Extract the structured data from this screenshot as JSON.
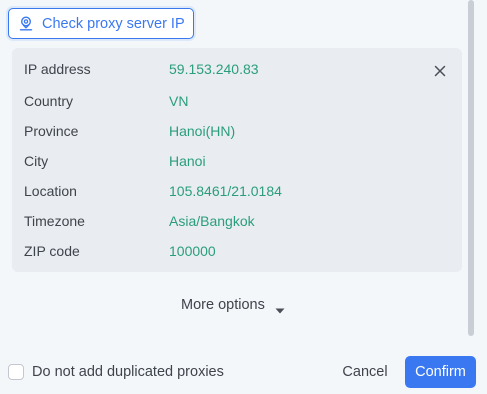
{
  "check_button": {
    "label": "Check proxy server IP",
    "icon": "location-pin-icon"
  },
  "info": {
    "rows": [
      {
        "label": "IP address",
        "value": "59.153.240.83"
      },
      {
        "label": "Country",
        "value": "VN"
      },
      {
        "label": "Province",
        "value": "Hanoi(HN)"
      },
      {
        "label": "City",
        "value": "Hanoi"
      },
      {
        "label": "Location",
        "value": "105.8461/21.0184"
      },
      {
        "label": "Timezone",
        "value": "Asia/Bangkok"
      },
      {
        "label": "ZIP code",
        "value": "100000"
      }
    ],
    "close_icon": "close-icon"
  },
  "more_options": {
    "label": "More options",
    "icon": "caret-down-icon"
  },
  "footer": {
    "checkbox_label": "Do not add duplicated proxies",
    "checkbox_checked": false,
    "cancel_label": "Cancel",
    "confirm_label": "Confirm"
  },
  "colors": {
    "accent": "#3a78f2",
    "value_green": "#2a9d7c",
    "panel_bg": "#e9edf1",
    "page_bg": "#f4f7fa"
  }
}
